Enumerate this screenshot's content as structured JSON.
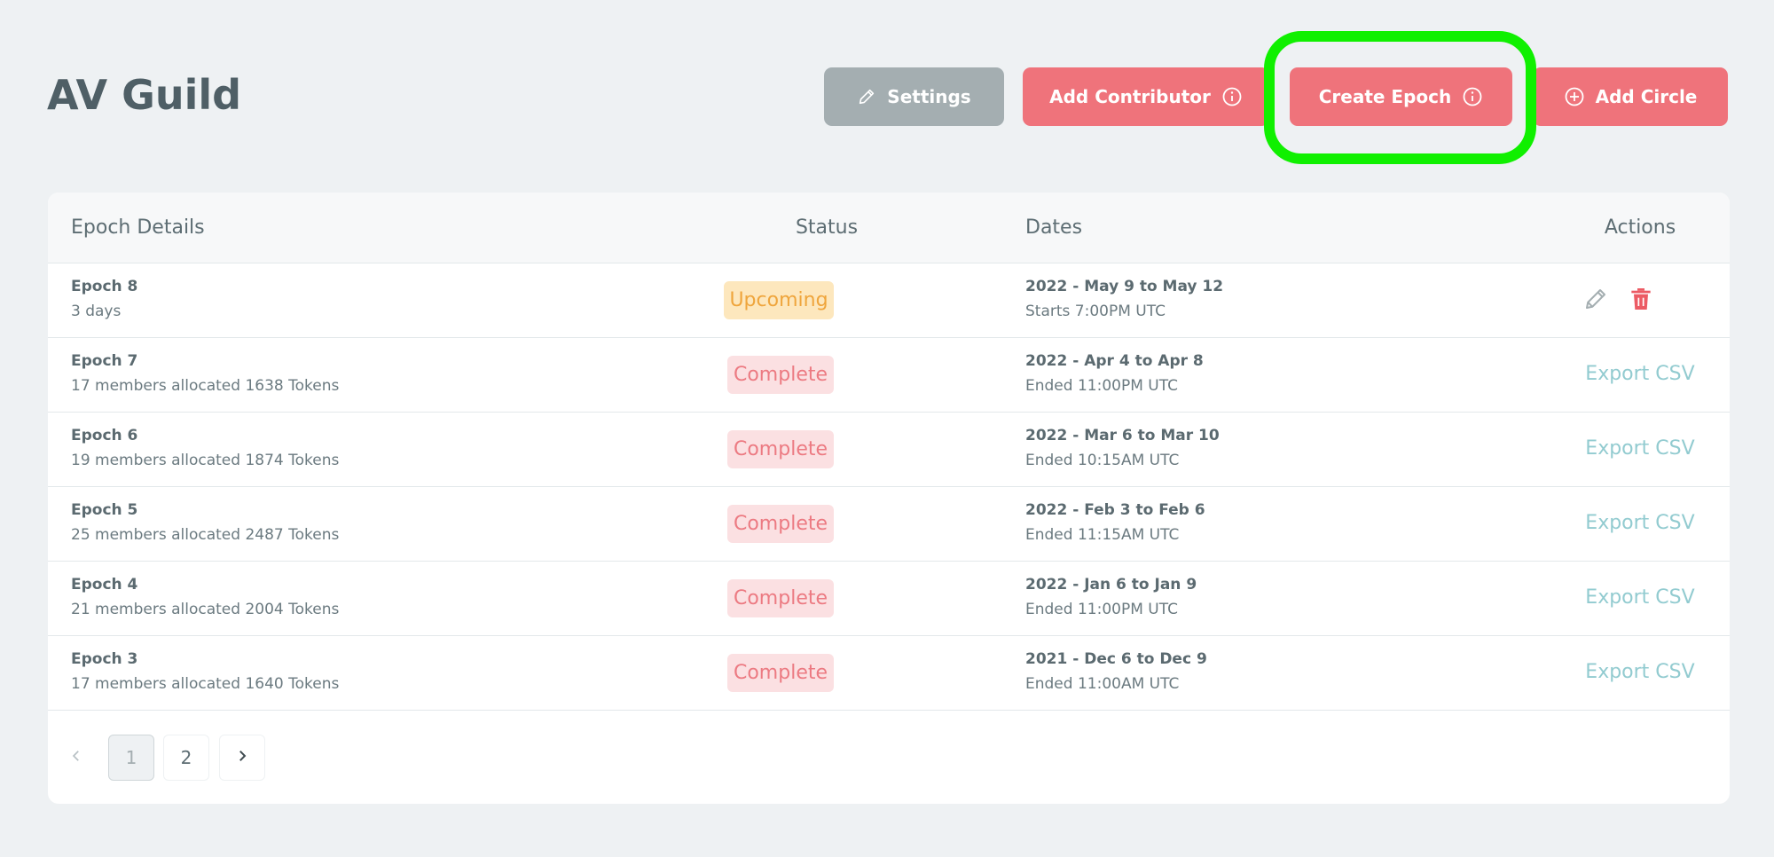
{
  "header": {
    "title": "AV Guild",
    "buttons": {
      "settings": "Settings",
      "add_contributor": "Add Contributor",
      "create_epoch": "Create Epoch",
      "add_circle": "Add Circle"
    }
  },
  "table": {
    "columns": {
      "details": "Epoch Details",
      "status": "Status",
      "dates": "Dates",
      "actions": "Actions"
    },
    "rows": [
      {
        "name": "Epoch 8",
        "sub": "3 days",
        "status": "Upcoming",
        "date": "2022 - May 9 to May 12",
        "time": "Starts 7:00PM UTC"
      },
      {
        "name": "Epoch 7",
        "sub": "17 members allocated 1638 Tokens",
        "status": "Complete",
        "date": "2022 - Apr 4 to Apr 8",
        "time": "Ended 11:00PM UTC",
        "action": "Export CSV"
      },
      {
        "name": "Epoch 6",
        "sub": "19 members allocated 1874 Tokens",
        "status": "Complete",
        "date": "2022 - Mar 6 to Mar 10",
        "time": "Ended 10:15AM UTC",
        "action": "Export CSV"
      },
      {
        "name": "Epoch 5",
        "sub": "25 members allocated 2487 Tokens",
        "status": "Complete",
        "date": "2022 - Feb 3 to Feb 6",
        "time": "Ended 11:15AM UTC",
        "action": "Export CSV"
      },
      {
        "name": "Epoch 4",
        "sub": "21 members allocated 2004 Tokens",
        "status": "Complete",
        "date": "2022 - Jan 6 to Jan 9",
        "time": "Ended 11:00PM UTC",
        "action": "Export CSV"
      },
      {
        "name": "Epoch 3",
        "sub": "17 members allocated 1640 Tokens",
        "status": "Complete",
        "date": "2021 - Dec 6 to Dec 9",
        "time": "Ended 11:00AM UTC",
        "action": "Export CSV"
      }
    ]
  },
  "pagination": {
    "pages": [
      "1",
      "2"
    ],
    "current": "1"
  },
  "icons": {
    "settings": "pencil-icon",
    "info": "info-circle-icon",
    "add_circle": "plus-circle-icon",
    "edit": "pencil-icon",
    "delete": "trash-icon",
    "prev": "chevron-left-icon",
    "next": "chevron-right-icon"
  },
  "colors": {
    "accent": "#ef737b",
    "settings_button": "#a4aeb1",
    "upcoming_badge": "#efa53c",
    "complete_badge": "#ec7a82",
    "export_link": "#92cbd0",
    "highlight": "#10f000"
  }
}
